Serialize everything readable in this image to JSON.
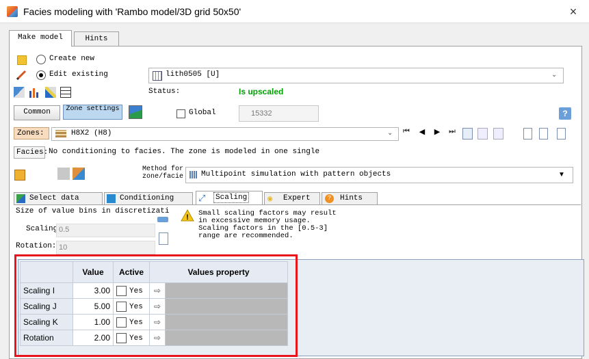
{
  "window": {
    "title": "Facies modeling with 'Rambo model/3D grid 50x50'",
    "close": "×"
  },
  "tabs": {
    "make_model": "Make model",
    "hints": "Hints"
  },
  "mode": {
    "create_new": "Create new",
    "edit_existing": "Edit existing",
    "selected": "edit_existing"
  },
  "property": {
    "value": "lith0505 [U]"
  },
  "status": {
    "label": "Status:",
    "value": "Is upscaled",
    "color": "#00a000"
  },
  "buttons": {
    "common": "Common",
    "zone_settings": "Zone settings",
    "help": "?"
  },
  "global": {
    "label": "Global",
    "value": "15332"
  },
  "zones": {
    "label": "Zones:",
    "value": "H8X2 (H8)"
  },
  "facies": {
    "label": "Facies:",
    "text": "No conditioning to facies. The zone is modeled in one single"
  },
  "method": {
    "label": "Method for zone/facie",
    "value": "Multipoint simulation with pattern objects"
  },
  "inner_tabs": [
    "Select data",
    "Conditioning",
    "Scaling",
    "Expert",
    "Hints"
  ],
  "scaling": {
    "size_label": "Size of value bins in discretizati",
    "scaling_label": "Scaling:",
    "scaling_value": "0.5",
    "rotation_label": "Rotation:",
    "rotation_value": "10",
    "warning": [
      "Small scaling factors may result",
      "in excessive memory usage.",
      "Scaling factors in the [0.5-3]",
      "range are recommended."
    ]
  },
  "grid": {
    "headers": [
      "Value",
      "Active",
      "Values property"
    ],
    "rows": [
      {
        "name": "Scaling I",
        "value": "3.00",
        "active": "Yes"
      },
      {
        "name": "Scaling J",
        "value": "5.00",
        "active": "Yes"
      },
      {
        "name": "Scaling K",
        "value": "1.00",
        "active": "Yes"
      },
      {
        "name": "Rotation",
        "value": "2.00",
        "active": "Yes"
      }
    ]
  },
  "highlight_color": "#e8141c"
}
